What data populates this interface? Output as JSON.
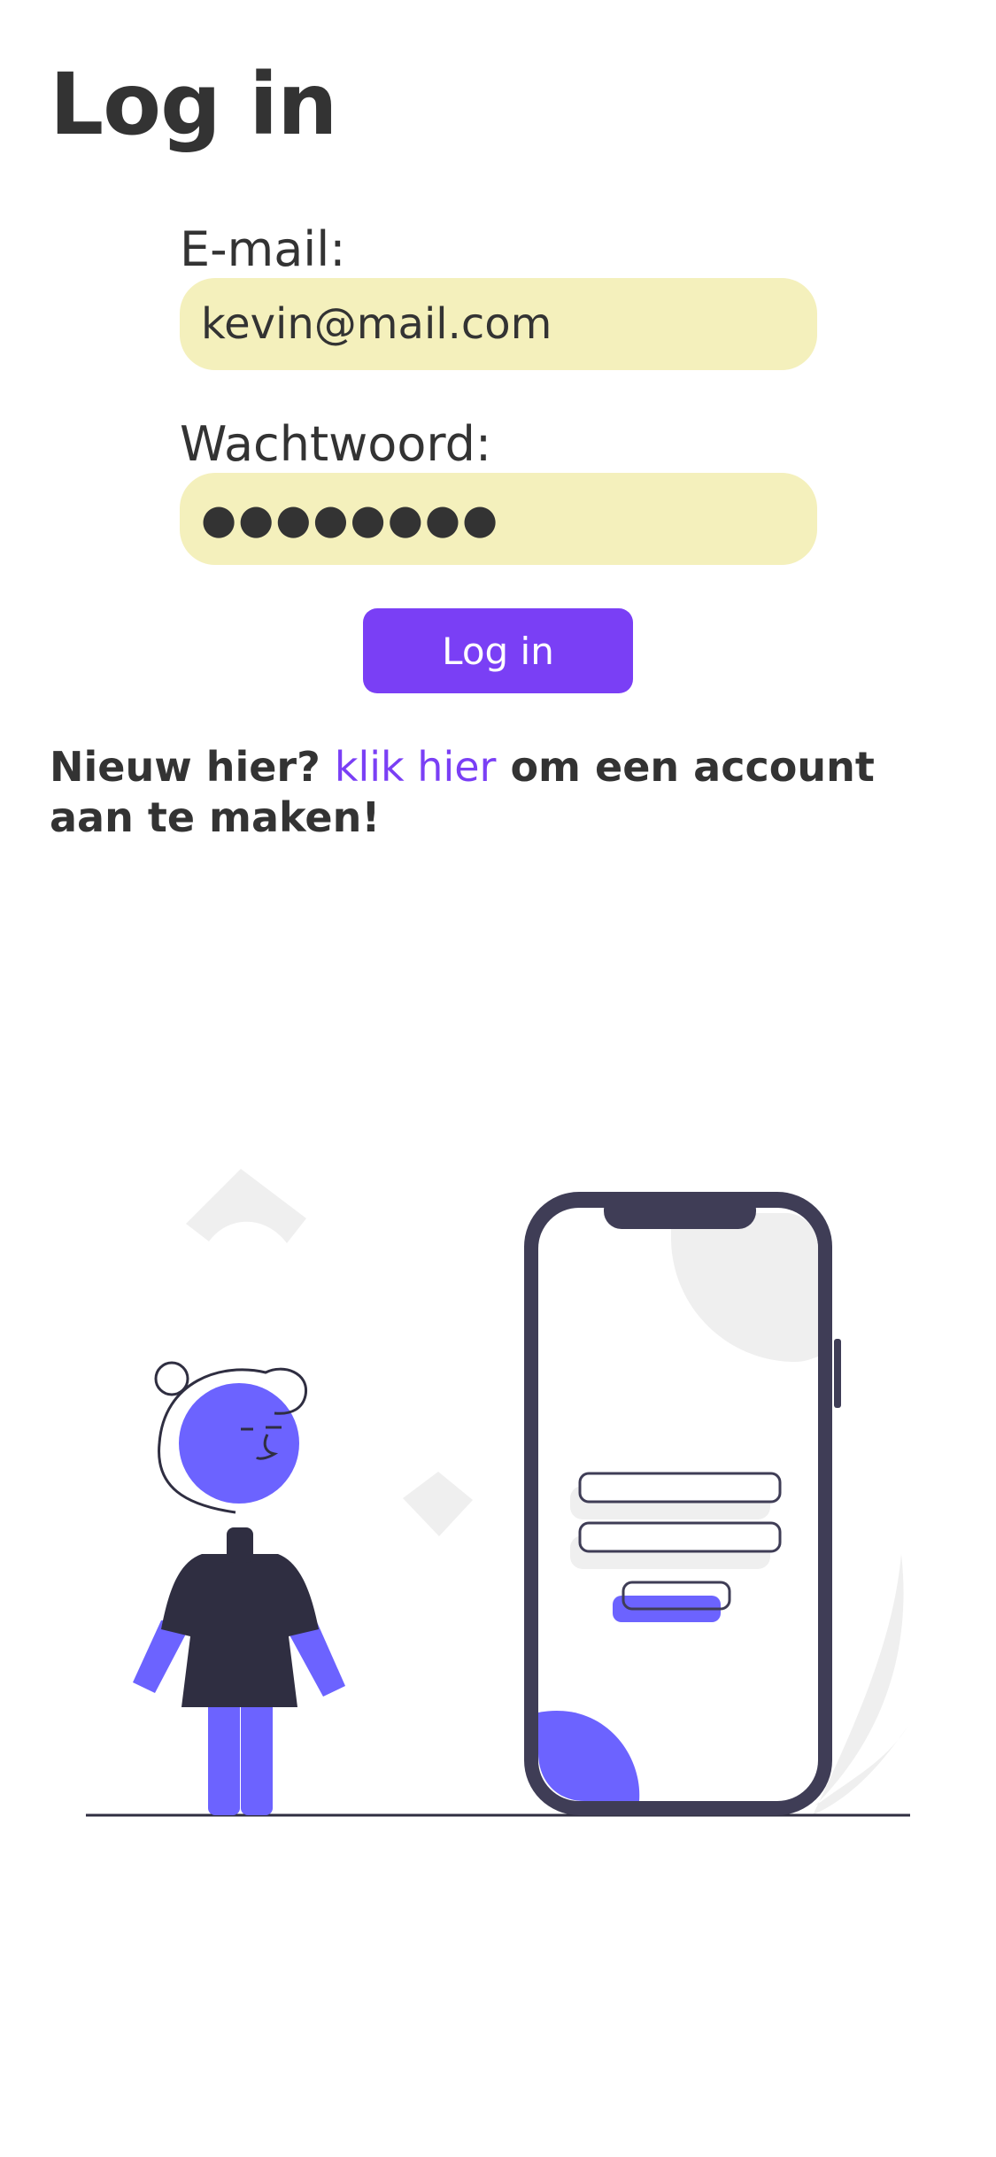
{
  "page": {
    "title": "Log in"
  },
  "form": {
    "email_label": "E-mail:",
    "email_value": "kevin@mail.com",
    "password_label": "Wachtwoord:",
    "password_value": "●●●●●●●●",
    "submit_label": "Log in"
  },
  "signup": {
    "prefix": "Nieuw hier?",
    "link_text": "klik hier",
    "suffix": "om een account aan te maken!"
  },
  "colors": {
    "accent": "#7a3ff5",
    "illustration_purple": "#6c63ff",
    "input_background": "#f4f0bc",
    "text": "#333333"
  },
  "illustration": {
    "icon": "person-with-phone-login-illustration"
  }
}
